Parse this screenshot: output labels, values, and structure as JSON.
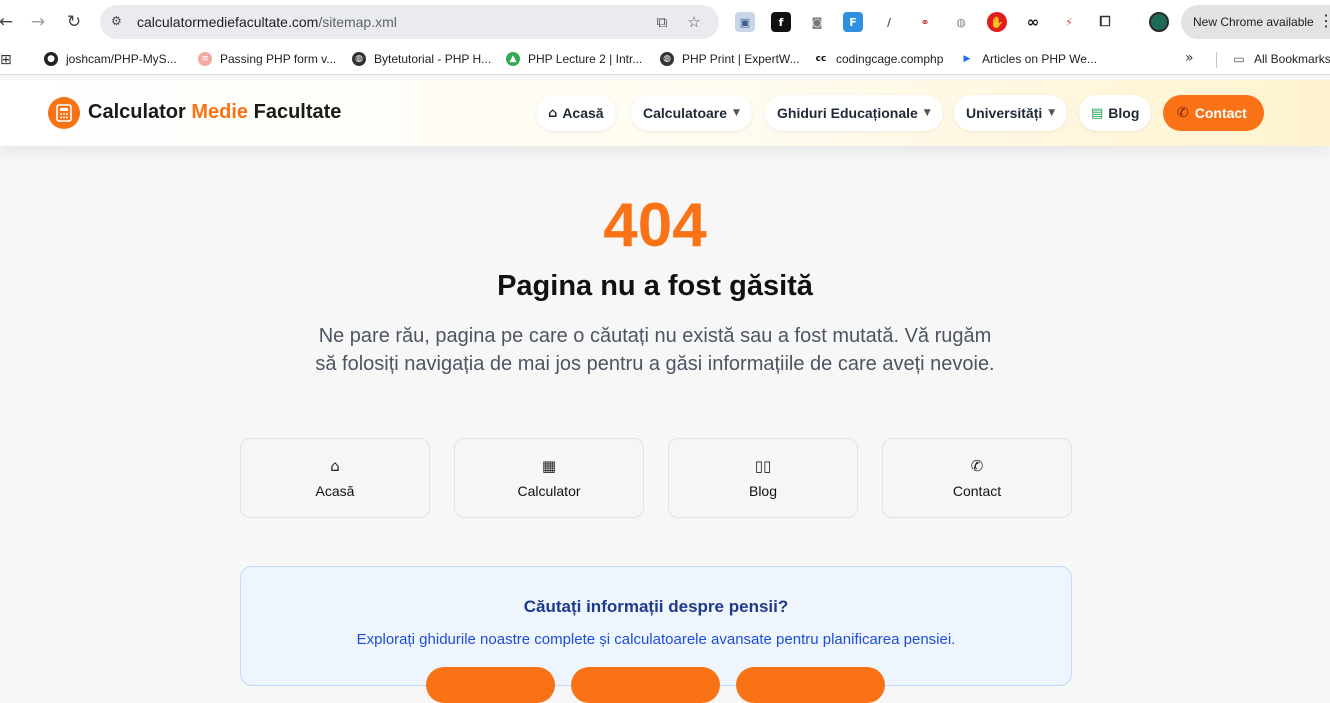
{
  "browser": {
    "url_host": "calculatormediefacultate.com",
    "url_path": "/sitemap.xml",
    "update_label": "New Chrome available"
  },
  "bookmarks": {
    "items": [
      {
        "label": "joshcam/PHP-MyS...",
        "icon": "github-icon"
      },
      {
        "label": "Passing PHP form v...",
        "icon": "site-icon"
      },
      {
        "label": "Bytetutorial - PHP H...",
        "icon": "globe-icon"
      },
      {
        "label": "PHP Lecture 2 | Intr...",
        "icon": "drive-icon"
      },
      {
        "label": "PHP Print | ExpertW...",
        "icon": "globe-icon"
      },
      {
        "label": "codingcage.comphp",
        "icon": "cc-icon"
      },
      {
        "label": "Articles on PHP We...",
        "icon": "arrow-icon"
      }
    ],
    "all_bookmarks": "All Bookmarks"
  },
  "site": {
    "brand_main": "Calculator",
    "brand_accent": "Medie",
    "brand_tail": "Facultate",
    "nav": {
      "home": "Acasă",
      "calculators": "Calculatoare",
      "guides": "Ghiduri Educaționale",
      "universities": "Universități",
      "blog": "Blog",
      "contact": "Contact"
    }
  },
  "error": {
    "code": "404",
    "title": "Pagina nu a fost găsită",
    "description": "Ne pare rău, pagina pe care o căutați nu există sau a fost mutată. Vă rugăm să folosiți navigația de mai jos pentru a găsi informațiile de care aveți nevoie."
  },
  "quick_links": [
    {
      "label": "Acasă",
      "icon": "home-icon"
    },
    {
      "label": "Calculator",
      "icon": "calculator-icon"
    },
    {
      "label": "Blog",
      "icon": "book-icon"
    },
    {
      "label": "Contact",
      "icon": "phone-icon"
    }
  ],
  "info": {
    "title": "Căutați informații despre pensii?",
    "text": "Explorați ghidurile noastre complete și calculatoarele avansate pentru planificarea pensiei."
  },
  "colors": {
    "accent": "#f97316",
    "info_title": "#1e3a8a",
    "info_text": "#1d4ed8"
  }
}
